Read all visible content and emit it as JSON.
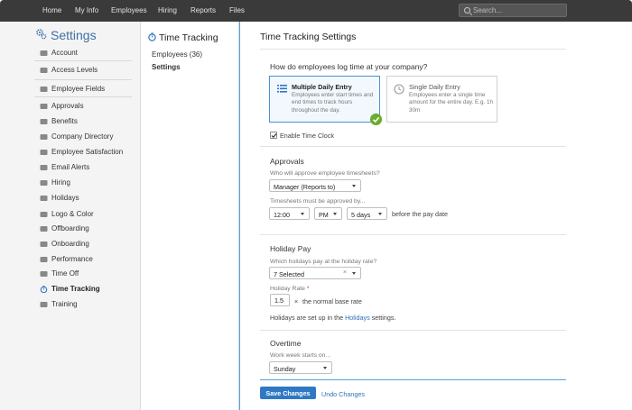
{
  "topnav": {
    "items": [
      "Home",
      "My Info",
      "Employees",
      "Hiring",
      "Reports",
      "Files"
    ],
    "search_placeholder": "Search..."
  },
  "sidebar": {
    "title": "Settings",
    "items": [
      {
        "label": "Account",
        "icon": "wrench-icon"
      },
      {
        "label": "Access Levels",
        "icon": "access-levels-icon"
      },
      {
        "label": "Employee Fields",
        "icon": "fields-icon"
      },
      {
        "label": "Approvals",
        "icon": "thumbs-up-icon"
      },
      {
        "label": "Benefits",
        "icon": "heart-icon"
      },
      {
        "label": "Company Directory",
        "icon": "directory-icon"
      },
      {
        "label": "Employee Satisfaction",
        "icon": "satisfaction-icon"
      },
      {
        "label": "Email Alerts",
        "icon": "email-icon"
      },
      {
        "label": "Hiring",
        "icon": "hiring-icon"
      },
      {
        "label": "Holidays",
        "icon": "calendar-icon"
      },
      {
        "label": "Logo & Color",
        "icon": "paint-icon"
      },
      {
        "label": "Offboarding",
        "icon": "offboarding-icon"
      },
      {
        "label": "Onboarding",
        "icon": "onboarding-icon"
      },
      {
        "label": "Performance",
        "icon": "performance-icon"
      },
      {
        "label": "Time Off",
        "icon": "time-off-icon"
      },
      {
        "label": "Time Tracking",
        "icon": "stopwatch-icon"
      },
      {
        "label": "Training",
        "icon": "training-icon"
      }
    ]
  },
  "subpanel": {
    "title": "Time Tracking",
    "links": [
      "Employees (36)",
      "Settings"
    ]
  },
  "main": {
    "title": "Time Tracking Settings",
    "log_question": "How do employees log time at your company?",
    "cards": [
      {
        "title": "Multiple Daily Entry",
        "desc": "Employees enter start times and end times to track hours throughout the day."
      },
      {
        "title": "Single Daily Entry",
        "desc": "Employees enter a single time amount for the entire day. E.g. 1h 30m"
      }
    ],
    "enable_clock_label": "Enable Time Clock",
    "approvals": {
      "heading": "Approvals",
      "who_label": "Who will approve employee timesheets?",
      "who_value": "Manager (Reports to)",
      "by_label": "Timesheets must be approved by...",
      "time_value": "12:00",
      "ampm_value": "PM",
      "days_value": "5 days",
      "suffix": "before the pay date"
    },
    "holiday": {
      "heading": "Holiday Pay",
      "which_label": "Which holidays pay at the holiday rate?",
      "which_value": "7 Selected",
      "clear_symbol": "×",
      "rate_label": "Holiday Rate",
      "required_mark": "*",
      "rate_value": "1.5",
      "times_symbol": "×",
      "rate_suffix": "the normal base rate",
      "note_pre": "Holidays are set up in the",
      "note_link": "Holidays",
      "note_post": "settings."
    },
    "overtime": {
      "heading": "Overtime",
      "week_label": "Work week starts on...",
      "week_value": "Sunday"
    },
    "save_label": "Save Changes",
    "undo_label": "Undo Changes"
  },
  "colors": {
    "topbar": "#3a3a3a",
    "accent_blue": "#2f78c4",
    "settings_blue": "#3c6fa8",
    "check_green": "#6aad2f"
  }
}
